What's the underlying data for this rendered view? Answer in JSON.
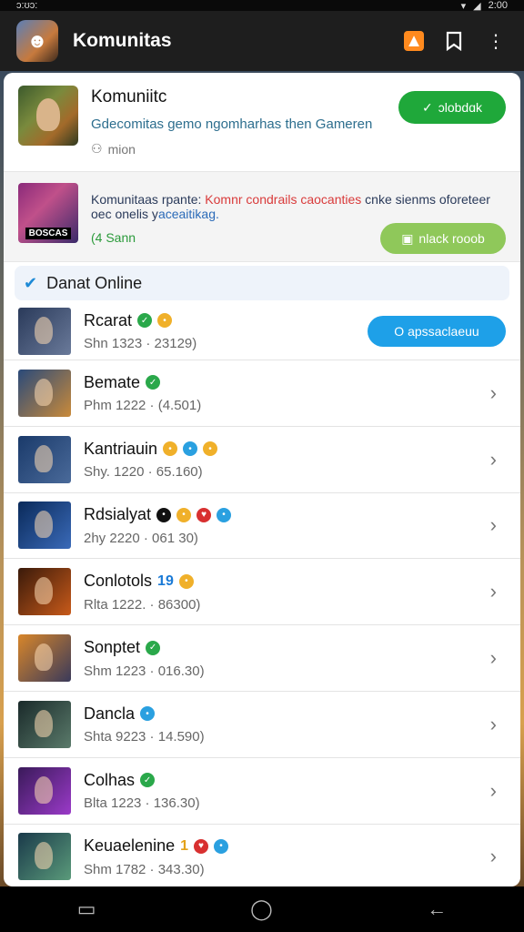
{
  "status": {
    "left": "ɔ:ʊɔ:",
    "right": "2:00"
  },
  "app_bar": {
    "title": "Komunitas"
  },
  "community": {
    "name": "Komuniitc",
    "description": "Gdecomitas gemo ngomharhas then Gameren",
    "members": "mion",
    "join_label": "ɔlobdɑk"
  },
  "promo": {
    "thumb_label": "BOSCAS",
    "text_a": "Komunitaas rpante:",
    "text_b": "Komnr condrails",
    "text_c": "caocanties",
    "text_d": "cnke sienms oforeteer oec onelis y",
    "text_e": "aceaitikag.",
    "count": "(4 Sann",
    "button_label": "nlack rooob"
  },
  "section": {
    "title": "Danat Online"
  },
  "members": [
    {
      "name": "Rcarat",
      "meta": "Shn 1323 · 23129)",
      "badges": [
        "green",
        "gold"
      ],
      "action": "O apssaclaeuu",
      "avatar": [
        "#2a3a5a",
        "#6a7a9a"
      ]
    },
    {
      "name": "Bemate",
      "meta": "Phm 1222 · (4.501)",
      "badges": [
        "green"
      ],
      "avatar": [
        "#2a4a7a",
        "#c98a3a"
      ]
    },
    {
      "name": "Kantriauin",
      "meta": "Shy. 1220 · 65.160)",
      "badges": [
        "gold",
        "blue",
        "gold"
      ],
      "avatar": [
        "#1a3a6a",
        "#4a6a9a"
      ]
    },
    {
      "name": "Rdsialyat",
      "meta": "2hy 2220 · 061 30)",
      "badges": [
        "black",
        "gold",
        "red",
        "blue"
      ],
      "avatar": [
        "#0a2a5a",
        "#3a6ab8"
      ]
    },
    {
      "name": "Conlotols",
      "num": "19",
      "meta": "Rlta 1222. · 86300)",
      "badges": [
        "gold"
      ],
      "avatar": [
        "#3a1a0a",
        "#c85a1a"
      ]
    },
    {
      "name": "Sonptet",
      "meta": "Shm 1223 · 016.30)",
      "badges": [
        "green"
      ],
      "avatar": [
        "#d8862a",
        "#3a3a5a"
      ]
    },
    {
      "name": "Dancla",
      "meta": "Shta 9223 · 14.590)",
      "badges": [
        "blue"
      ],
      "avatar": [
        "#1a2a2a",
        "#5a7a6a"
      ]
    },
    {
      "name": "Colhas",
      "meta": "Blta 1223 · 136.30)",
      "badges": [
        "green"
      ],
      "avatar": [
        "#3a1a5a",
        "#9a3ac8"
      ]
    },
    {
      "name": "Keuaelenine",
      "num": "1",
      "meta": "Shm 1782 · 343.30)",
      "badges": [
        "red",
        "blue"
      ],
      "avatar": [
        "#1a3a4a",
        "#5a9a7a"
      ]
    }
  ],
  "colors": {
    "join": "#1fa83a",
    "message": "#1ea0e8",
    "promo_button": "#8fc85a"
  },
  "icons": {
    "app_bar": [
      "store-icon",
      "bookmark-icon",
      "more-vertical-icon"
    ],
    "nav": [
      "recent-apps-icon",
      "home-icon",
      "back-icon"
    ]
  }
}
